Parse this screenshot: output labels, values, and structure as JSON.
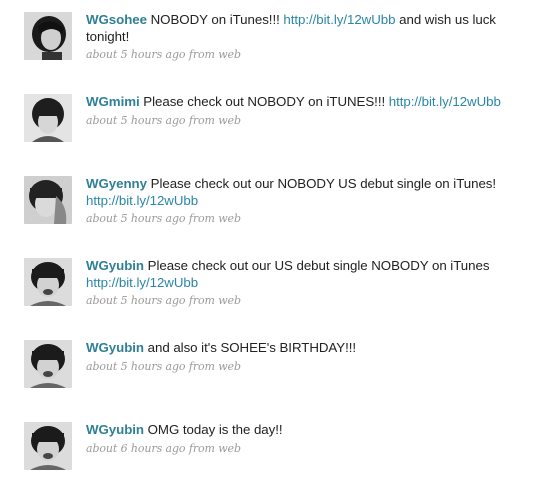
{
  "tweets": [
    {
      "username": "WGsohee",
      "text_before": " NOBODY on iTunes!!! ",
      "link": "http://bit.ly/12wUbb",
      "text_after": " and wish us luck tonight!",
      "timestamp": "about 5 hours ago",
      "from_label": "from",
      "source": "web"
    },
    {
      "username": "WGmimi",
      "text_before": " Please check out NOBODY on iTUNES!!! ",
      "link": "http://bit.ly/12wUbb",
      "text_after": "",
      "timestamp": "about 5 hours ago",
      "from_label": "from",
      "source": "web"
    },
    {
      "username": "WGyenny",
      "text_before": " Please check out our NOBODY US debut single on iTunes! ",
      "link": "http://bit.ly/12wUbb",
      "text_after": "",
      "timestamp": "about 5 hours ago",
      "from_label": "from",
      "source": "web"
    },
    {
      "username": "WGyubin",
      "text_before": " Please check out our US debut single NOBODY on iTunes ",
      "link": "http://bit.ly/12wUbb",
      "text_after": "",
      "timestamp": "about 5 hours ago",
      "from_label": "from",
      "source": "web"
    },
    {
      "username": "WGyubin",
      "text_before": " and also it's SOHEE's BIRTHDAY!!!",
      "link": "",
      "text_after": "",
      "timestamp": "about 5 hours ago",
      "from_label": "from",
      "source": "web"
    },
    {
      "username": "WGyubin",
      "text_before": " OMG today is the day!!",
      "link": "",
      "text_after": "",
      "timestamp": "about 6 hours ago",
      "from_label": "from",
      "source": "web"
    }
  ],
  "colors": {
    "username": "#2f7f97",
    "link": "#2a86a8",
    "text": "#222222",
    "meta": "#9a9a9a"
  },
  "icons": {
    "avatar": "profile-photo-icon"
  }
}
